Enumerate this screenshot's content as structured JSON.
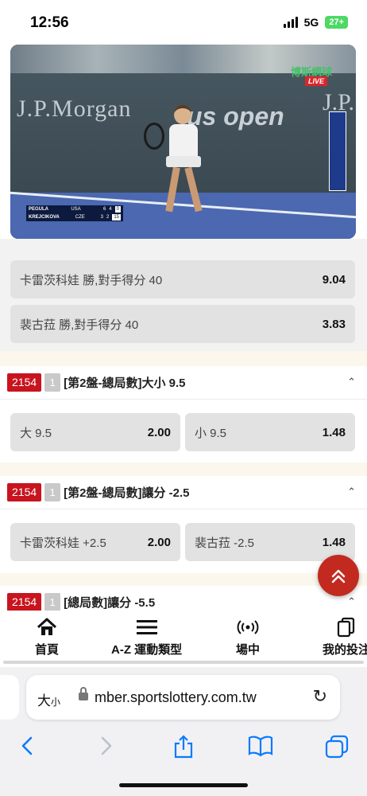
{
  "status_bar": {
    "time": "12:56",
    "network": "5G",
    "battery": "27+"
  },
  "video": {
    "brand_left": "J.P.Morgan",
    "brand_center": "us open",
    "brand_right": "J.P.",
    "live_channel": "博斯網球",
    "live_tag": "LIVE",
    "scoreboard": [
      {
        "player": "PEGULA",
        "country": "USA",
        "sets": [
          "6",
          "4"
        ],
        "game": "0"
      },
      {
        "player": "KREJCIKOVA",
        "country": "CZE",
        "sets": [
          "3",
          "2"
        ],
        "game": "15"
      }
    ]
  },
  "markets": {
    "top_cards": [
      {
        "label": "卡雷茨科娃 勝,對手得分 40",
        "odds": "9.04"
      },
      {
        "label": "裴古菈 勝,對手得分 40",
        "odds": "3.83"
      }
    ],
    "sections": [
      {
        "id": "2154",
        "count": "1",
        "title": "[第2盤-總局數]大小 9.5",
        "options": [
          {
            "label": "大 9.5",
            "odds": "2.00"
          },
          {
            "label": "小 9.5",
            "odds": "1.48"
          }
        ]
      },
      {
        "id": "2154",
        "count": "1",
        "title": "[第2盤-總局數]讓分 -2.5",
        "options": [
          {
            "label": "卡雷茨科娃 +2.5",
            "odds": "2.00"
          },
          {
            "label": "裴古菈 -2.5",
            "odds": "1.48"
          }
        ]
      },
      {
        "id": "2154",
        "count": "1",
        "title": "[總局數]讓分 -5.5"
      }
    ]
  },
  "bottom_nav": [
    {
      "label": "首頁",
      "icon": "home-icon"
    },
    {
      "label": "A-Z 運動類型",
      "icon": "menu-icon"
    },
    {
      "label": "場中",
      "icon": "live-signal-icon"
    },
    {
      "label": "我的投注",
      "icon": "copy-icon"
    }
  ],
  "browser": {
    "aa_label": "大",
    "aa_small": "小",
    "url": "mber.sportslottery.com.tw",
    "toolbar": [
      "back-icon",
      "forward-icon",
      "share-icon",
      "bookmarks-icon",
      "tabs-icon"
    ]
  },
  "colors": {
    "accent_red": "#c8141e",
    "fab_red": "#c22a20",
    "ios_blue": "#0a7aff"
  }
}
